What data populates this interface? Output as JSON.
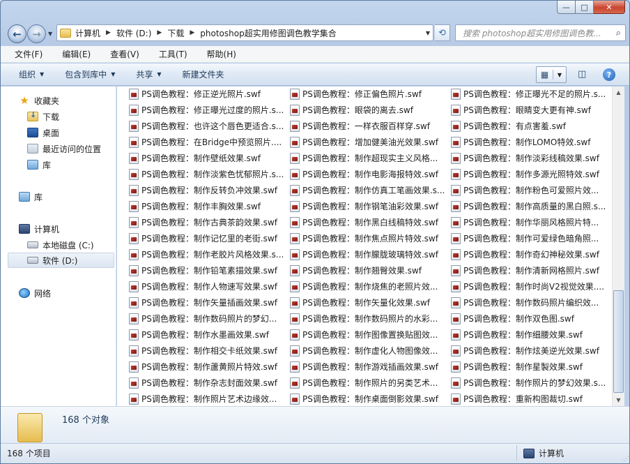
{
  "window": {
    "caption": {
      "minimize": "—",
      "maximize": "□",
      "close": "✕"
    }
  },
  "nav": {
    "back": "←",
    "forward": "→",
    "dropdown": "▼",
    "breadcrumb": [
      "计算机",
      "软件 (D:)",
      "下载",
      "photoshop超实用修图调色教学集合"
    ],
    "address_dropdown": "▼",
    "refresh": "⟲",
    "search_placeholder": "搜索 photoshop超实用修图调色教...",
    "search_icon": "⌕"
  },
  "menu": [
    "文件(F)",
    "编辑(E)",
    "查看(V)",
    "工具(T)",
    "帮助(H)"
  ],
  "commands": {
    "organize": "组织",
    "include_library": "包含到库中",
    "share": "共享",
    "new_folder": "新建文件夹",
    "dd": "▼",
    "view_grid": "▦",
    "view_dd": "▼",
    "preview_icon": "◫",
    "help": "?"
  },
  "sidebar": {
    "favorites": "收藏夹",
    "downloads": "下载",
    "desktop": "桌面",
    "recent": "最近访问的位置",
    "library_fav": "库",
    "library": "库",
    "computer": "计算机",
    "local_disk": "本地磁盘 (C:)",
    "software_disk": "软件 (D:)",
    "network": "网络"
  },
  "files": {
    "col1": [
      "PS调色教程：修正逆光照片.swf",
      "PS调色教程：修正曝光过度的照片.s...",
      "PS调色教程：也许这个唇色更适合.s...",
      "PS调色教程：在Bridge中预览照片....",
      "PS调色教程：制作壁纸效果.swf",
      "PS调色教程：制作淡紫色忧郁照片.s...",
      "PS调色教程：制作反转负冲效果.swf",
      "PS调色教程：制作丰胸效果.swf",
      "PS调色教程：制作古典茶韵效果.swf",
      "PS调色教程：制作记忆里的老街.swf",
      "PS调色教程：制作老胶片风格效果.s...",
      "PS调色教程：制作铅笔素描效果.swf",
      "PS调色教程：制作人物速写效果.swf",
      "PS调色教程：制作矢量插画效果.swf",
      "PS调色教程：制作数码照片的梦幻...",
      "PS调色教程：制作水墨画效果.swf",
      "PS调色教程：制作相交卡纸效果.swf",
      "PS调色教程：制作蘆黄照片特效.swf",
      "PS调色教程：制作杂志封面效果.swf",
      "PS调色教程：制作照片艺术边缘效..."
    ],
    "col2": [
      "PS调色教程：修正偏色照片.swf",
      "PS调色教程：眼袋的离去.swf",
      "PS调色教程：一样衣服百样穿.swf",
      "PS调色教程：增加健美油光效果.swf",
      "PS调色教程：制作超现实主义风格...",
      "PS调色教程：制作电影海报特效.swf",
      "PS调色教程：制作仿真工笔画效果.s...",
      "PS调色教程：制作钢笔油彩效果.swf",
      "PS调色教程：制作黑白线稿特效.swf",
      "PS调色教程：制作焦点照片特效.swf",
      "PS调色教程：制作朦胧玻璃特效.swf",
      "PS调色教程：制作翘臀效果.swf",
      "PS调色教程：制作烧焦的老照片效...",
      "PS调色教程：制作矢量化效果.swf",
      "PS调色教程：制作数码照片的水彩...",
      "PS调色教程：制作图像置换贴图效...",
      "PS调色教程：制作虚化人物图像效...",
      "PS调色教程：制作游戏插画效果.swf",
      "PS调色教程：制作照片的另类艺术...",
      "PS调色教程：制作桌面倒影效果.swf"
    ],
    "col3": [
      "PS调色教程：修正曝光不足的照片.s...",
      "PS调色教程：眼睛变大更有神.swf",
      "PS调色教程：有点害羞.swf",
      "PS调色教程：制作LOMO特效.swf",
      "PS调色教程：制作淡彩线稿效果.swf",
      "PS调色教程：制作多源光照特效.swf",
      "PS调色教程：制作粉色可爱照片效...",
      "PS调色教程：制作高质量的黑白照.s...",
      "PS调色教程：制作华丽风格照片特...",
      "PS调色教程：制作可爱绿色暗角照...",
      "PS调色教程：制作奇幻神秘效果.swf",
      "PS调色教程：制作清新网格照片.swf",
      "PS调色教程：制作时尚V2视觉效果....",
      "PS调色教程：制作数码照片编织效...",
      "PS调色教程：制作双色图.swf",
      "PS调色教程：制作细腰效果.swf",
      "PS调色教程：制作炫美逆光效果.swf",
      "PS调色教程：制作星製效果.swf",
      "PS调色教程：制作照片的梦幻效果.s...",
      "PS调色教程：重新构图裁切.swf"
    ]
  },
  "scroll": {
    "up": "▲",
    "down": "▼"
  },
  "details": {
    "count": "168 个对象"
  },
  "status": {
    "items": "168 个项目",
    "computer": "计算机",
    "grip": "⋰"
  }
}
